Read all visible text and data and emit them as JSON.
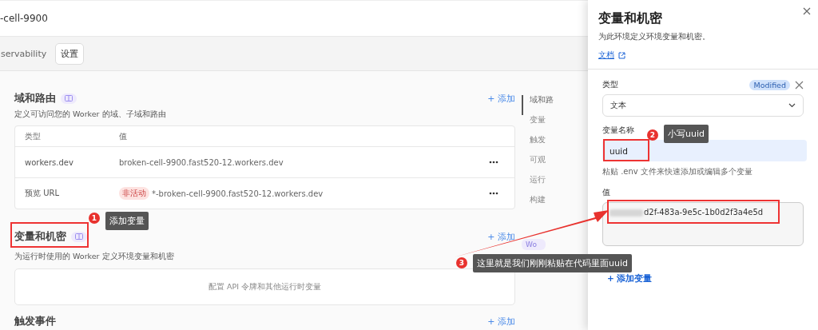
{
  "header": {
    "title": "-cell-9900"
  },
  "tabs": [
    {
      "label": "servability",
      "selected": false
    },
    {
      "label": "设置",
      "selected": true
    }
  ],
  "sections": [
    {
      "title": "域和路由",
      "add": "+ 添加",
      "description": "定义可访问您的 Worker 的域、子域和路由",
      "table": {
        "columns": [
          "类型",
          "值"
        ],
        "rows": [
          {
            "type": "workers.dev",
            "value": "broken-cell-9900.fast520-12.workers.dev"
          },
          {
            "type": "预览 URL",
            "status": "非活动",
            "value": "*-broken-cell-9900.fast520-12.workers.dev"
          }
        ]
      }
    },
    {
      "title": "变量和机密",
      "add": "+ 添加",
      "description": "为运行时使用的 Worker 定义环境变量和机密",
      "empty": "配置 API 令牌和其他运行时变量"
    },
    {
      "title": "触发事件",
      "add": "+ 添加"
    }
  ],
  "side_nav": [
    {
      "label": "域和路",
      "selected": true
    },
    {
      "label": "变量",
      "selected": false
    },
    {
      "label": "触发",
      "selected": false
    },
    {
      "label": "可观",
      "selected": false
    },
    {
      "label": "运行",
      "selected": false
    },
    {
      "label": "构建",
      "selected": false
    }
  ],
  "side_badge": "Wo",
  "panel": {
    "title": "变量和机密",
    "description": "为此环境定义环境变量和机密。",
    "doc_link": "文档",
    "type_label": "类型",
    "modified": "Modified",
    "type_value": "文本",
    "name_label": "变量名称",
    "name_value": "uuid",
    "name_hint": "粘贴 .env 文件来快速添加或编辑多个变量",
    "value_label": "值",
    "value": "d2f-483a-9e5c-1b0d2f3a4e5d",
    "add_variable": "+ 添加变量"
  },
  "annotations": [
    {
      "number": "1",
      "text": "添加变量"
    },
    {
      "number": "2",
      "text": "小写uuid"
    },
    {
      "number": "3",
      "text": "这里就是我们刚刚粘贴在代码里面uuid"
    }
  ]
}
